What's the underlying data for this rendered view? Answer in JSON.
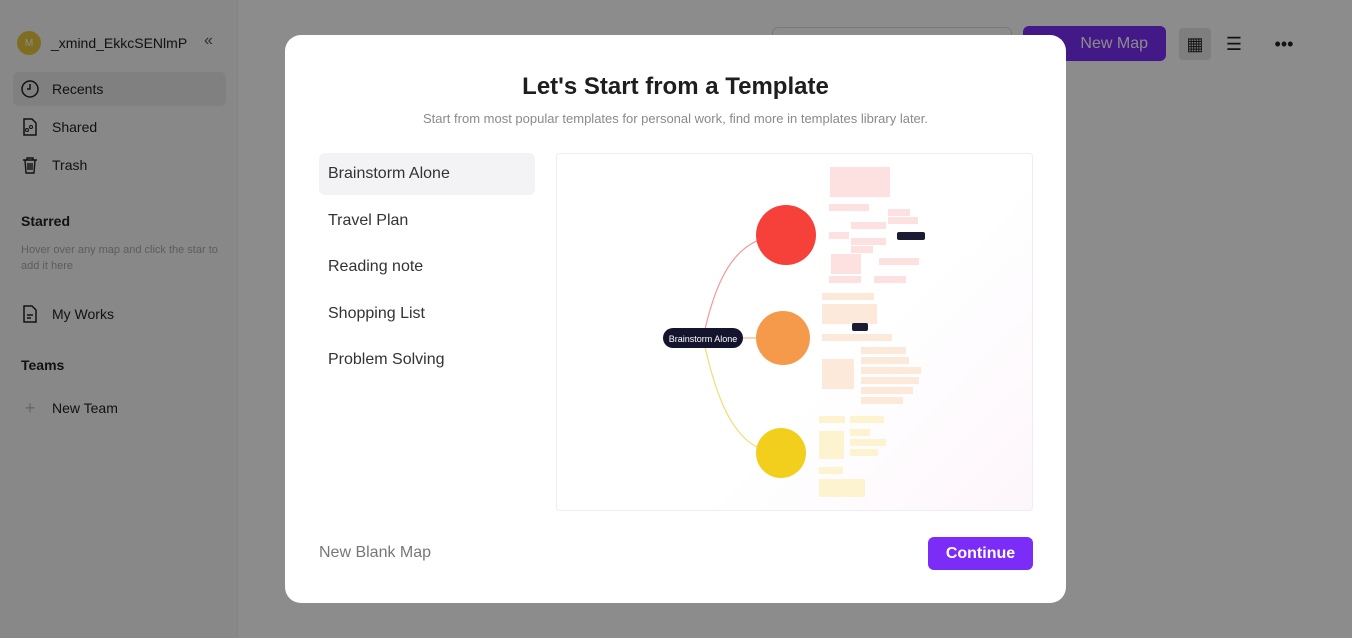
{
  "sidebar": {
    "user": {
      "initial": "M",
      "name": "_xmind_EkkcSENlmP"
    },
    "nav": [
      {
        "label": "Recents",
        "icon": "clock-icon"
      },
      {
        "label": "Shared",
        "icon": "shared-file-icon"
      },
      {
        "label": "Trash",
        "icon": "trash-icon"
      }
    ],
    "starred": {
      "title": "Starred",
      "hint": "Hover over any map and click the star to add it here"
    },
    "my_works": "My Works",
    "teams": {
      "title": "Teams",
      "new_team": "New Team"
    }
  },
  "topbar": {
    "new_map": "New Map",
    "icons": [
      "grid-view-icon",
      "list-view-icon",
      "more-icon"
    ]
  },
  "modal": {
    "title": "Let's Start from a Template",
    "subtitle": "Start from most popular templates for personal work, find more in templates library later.",
    "templates": [
      "Brainstorm Alone",
      "Travel Plan",
      "Reading note",
      "Shopping List",
      "Problem Solving"
    ],
    "selected": "Brainstorm Alone",
    "preview": {
      "root": "Brainstorm Alone",
      "colors": [
        "#f5413a",
        "#f59a4a",
        "#f2cf1c"
      ]
    },
    "new_blank": "New Blank Map",
    "continue": "Continue"
  },
  "colors": {
    "accent": "#7b2cf6"
  }
}
